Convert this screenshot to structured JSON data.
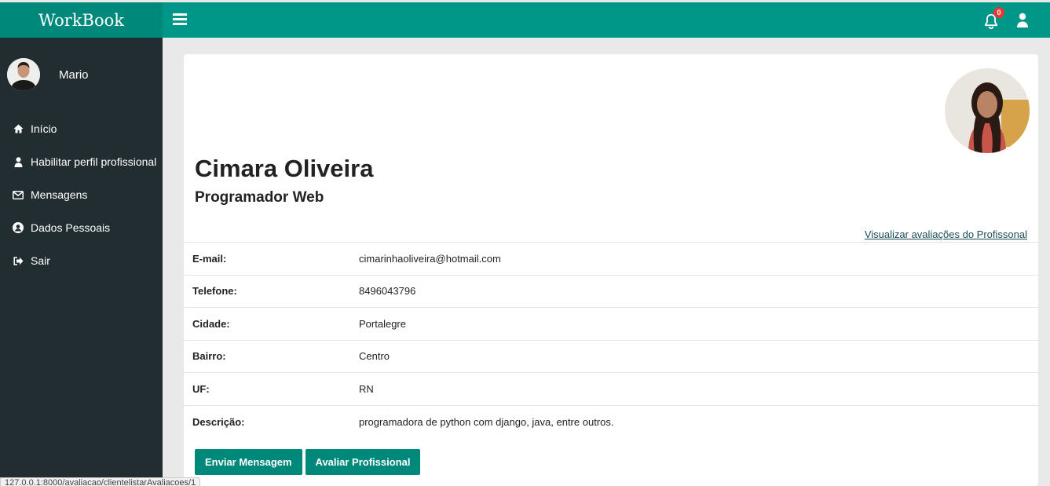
{
  "app": {
    "brand": "WorkBook",
    "notification_count": "0"
  },
  "icons": {
    "menu": "hamburger-icon",
    "bell": "bell-icon",
    "user": "user-icon",
    "home": "home-icon",
    "person": "person-icon",
    "mail": "envelope-icon",
    "account": "user-circle-icon",
    "exit": "sign-out-icon"
  },
  "colors": {
    "header": "#009688",
    "brand": "#00897b",
    "sidebar": "#222d32",
    "button": "#00897b",
    "badge": "#e53935"
  },
  "sidebar": {
    "user_name": "Mario",
    "items": [
      {
        "label": "Início"
      },
      {
        "label": "Habilitar perfil profissional"
      },
      {
        "label": "Mensagens"
      },
      {
        "label": "Dados Pessoais"
      },
      {
        "label": "Sair"
      }
    ]
  },
  "profile": {
    "name": "Cimara Oliveira",
    "role": "Programador Web",
    "reviews_link": "Visualizar avaliações do Profissonal",
    "fields": [
      {
        "label": "E-mail:",
        "value": "cimarinhaoliveira@hotmail.com"
      },
      {
        "label": "Telefone:",
        "value": "8496043796"
      },
      {
        "label": "Cidade:",
        "value": "Portalegre"
      },
      {
        "label": "Bairro:",
        "value": "Centro"
      },
      {
        "label": "UF:",
        "value": "RN"
      },
      {
        "label": "Descrição:",
        "value": "programadora de python com django, java, entre outros."
      }
    ],
    "buttons": {
      "send_message": "Enviar Mensagem",
      "rate": "Avaliar Profissional"
    }
  },
  "status_url": "127.0.0.1:8000/avaliacao/clientelistarAvaliacoes/1"
}
